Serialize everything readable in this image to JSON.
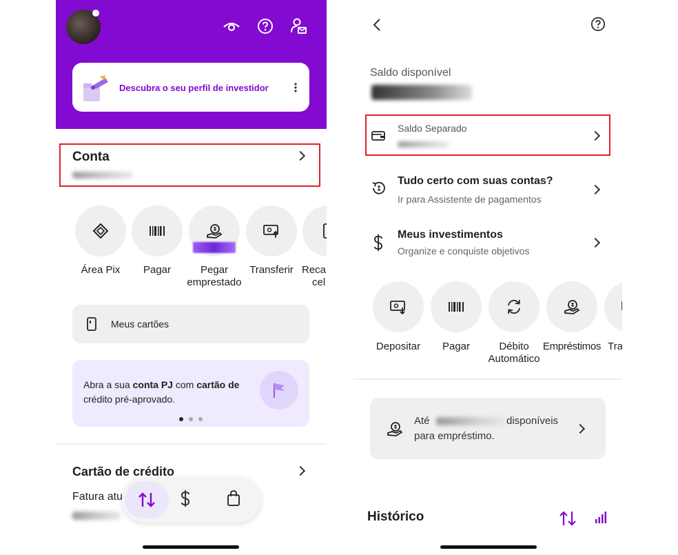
{
  "left": {
    "banner": {
      "text": "Descubra o seu perfil de investidor"
    },
    "conta": {
      "title": "Conta"
    },
    "actions": [
      {
        "label": "Área Pix",
        "icon": "pix-icon"
      },
      {
        "label": "Pagar",
        "icon": "barcode-icon"
      },
      {
        "label": "Pegar empréstado",
        "label_line1": "Pegar",
        "label_line2": "emprestado",
        "icon": "loan-hand-icon"
      },
      {
        "label": "Transferir",
        "icon": "transfer-icon"
      },
      {
        "label_line1": "Recar",
        "label_line2": "cel",
        "icon": "phone-icon"
      }
    ],
    "meus_cartoes": "Meus cartões",
    "promo": {
      "p1": "Abra a sua ",
      "b1": "conta PJ",
      "p2": " com ",
      "b2": "cartão de",
      "line2": "crédito pré-aprovado."
    },
    "credit": {
      "title": "Cartão de crédito",
      "fatura": "Fatura atu"
    }
  },
  "right": {
    "saldo_label": "Saldo disponível",
    "separado": {
      "label": "Saldo Separado"
    },
    "tudo_certo": {
      "title": "Tudo certo com suas contas?",
      "subtitle": "Ir para Assistente de pagamentos"
    },
    "investimentos": {
      "title": "Meus investimentos",
      "subtitle": "Organize e conquiste objetivos"
    },
    "actions": [
      {
        "label": "Depositar",
        "icon": "deposit-icon"
      },
      {
        "label": "Pagar",
        "icon": "barcode-icon"
      },
      {
        "label_line1": "Débito",
        "label_line2": "Automático",
        "icon": "refresh-icon"
      },
      {
        "label": "Empréstimos",
        "icon": "loan-hand-icon"
      },
      {
        "label": "Tra",
        "icon": "transfer-icon"
      }
    ],
    "loan_card": {
      "p1": "Até",
      "p2": "disponíveis",
      "line2": "para empréstimo."
    },
    "historico": "Histórico"
  },
  "colors": {
    "purple": "#820ad1",
    "light_purple": "#efeafd",
    "red_highlight": "#e0202a"
  }
}
